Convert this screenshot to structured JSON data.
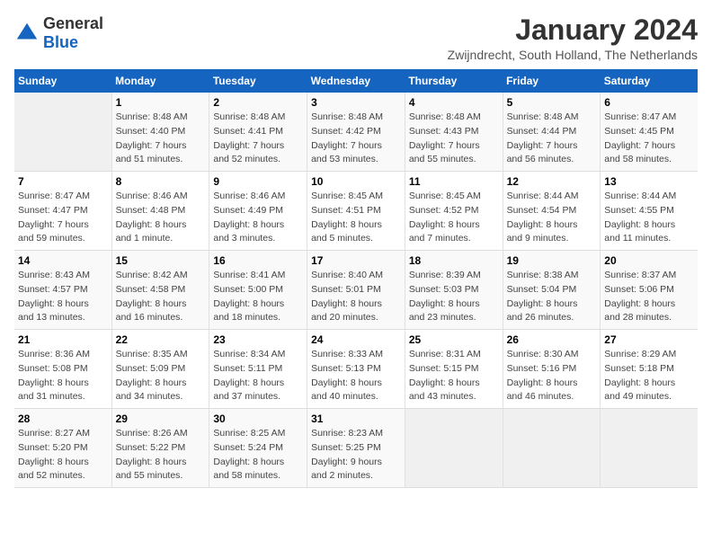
{
  "logo": {
    "general": "General",
    "blue": "Blue"
  },
  "title": "January 2024",
  "subtitle": "Zwijndrecht, South Holland, The Netherlands",
  "headers": [
    "Sunday",
    "Monday",
    "Tuesday",
    "Wednesday",
    "Thursday",
    "Friday",
    "Saturday"
  ],
  "weeks": [
    [
      {
        "day": "",
        "info": ""
      },
      {
        "day": "1",
        "info": "Sunrise: 8:48 AM\nSunset: 4:40 PM\nDaylight: 7 hours\nand 51 minutes."
      },
      {
        "day": "2",
        "info": "Sunrise: 8:48 AM\nSunset: 4:41 PM\nDaylight: 7 hours\nand 52 minutes."
      },
      {
        "day": "3",
        "info": "Sunrise: 8:48 AM\nSunset: 4:42 PM\nDaylight: 7 hours\nand 53 minutes."
      },
      {
        "day": "4",
        "info": "Sunrise: 8:48 AM\nSunset: 4:43 PM\nDaylight: 7 hours\nand 55 minutes."
      },
      {
        "day": "5",
        "info": "Sunrise: 8:48 AM\nSunset: 4:44 PM\nDaylight: 7 hours\nand 56 minutes."
      },
      {
        "day": "6",
        "info": "Sunrise: 8:47 AM\nSunset: 4:45 PM\nDaylight: 7 hours\nand 58 minutes."
      }
    ],
    [
      {
        "day": "7",
        "info": "Sunrise: 8:47 AM\nSunset: 4:47 PM\nDaylight: 7 hours\nand 59 minutes."
      },
      {
        "day": "8",
        "info": "Sunrise: 8:46 AM\nSunset: 4:48 PM\nDaylight: 8 hours\nand 1 minute."
      },
      {
        "day": "9",
        "info": "Sunrise: 8:46 AM\nSunset: 4:49 PM\nDaylight: 8 hours\nand 3 minutes."
      },
      {
        "day": "10",
        "info": "Sunrise: 8:45 AM\nSunset: 4:51 PM\nDaylight: 8 hours\nand 5 minutes."
      },
      {
        "day": "11",
        "info": "Sunrise: 8:45 AM\nSunset: 4:52 PM\nDaylight: 8 hours\nand 7 minutes."
      },
      {
        "day": "12",
        "info": "Sunrise: 8:44 AM\nSunset: 4:54 PM\nDaylight: 8 hours\nand 9 minutes."
      },
      {
        "day": "13",
        "info": "Sunrise: 8:44 AM\nSunset: 4:55 PM\nDaylight: 8 hours\nand 11 minutes."
      }
    ],
    [
      {
        "day": "14",
        "info": "Sunrise: 8:43 AM\nSunset: 4:57 PM\nDaylight: 8 hours\nand 13 minutes."
      },
      {
        "day": "15",
        "info": "Sunrise: 8:42 AM\nSunset: 4:58 PM\nDaylight: 8 hours\nand 16 minutes."
      },
      {
        "day": "16",
        "info": "Sunrise: 8:41 AM\nSunset: 5:00 PM\nDaylight: 8 hours\nand 18 minutes."
      },
      {
        "day": "17",
        "info": "Sunrise: 8:40 AM\nSunset: 5:01 PM\nDaylight: 8 hours\nand 20 minutes."
      },
      {
        "day": "18",
        "info": "Sunrise: 8:39 AM\nSunset: 5:03 PM\nDaylight: 8 hours\nand 23 minutes."
      },
      {
        "day": "19",
        "info": "Sunrise: 8:38 AM\nSunset: 5:04 PM\nDaylight: 8 hours\nand 26 minutes."
      },
      {
        "day": "20",
        "info": "Sunrise: 8:37 AM\nSunset: 5:06 PM\nDaylight: 8 hours\nand 28 minutes."
      }
    ],
    [
      {
        "day": "21",
        "info": "Sunrise: 8:36 AM\nSunset: 5:08 PM\nDaylight: 8 hours\nand 31 minutes."
      },
      {
        "day": "22",
        "info": "Sunrise: 8:35 AM\nSunset: 5:09 PM\nDaylight: 8 hours\nand 34 minutes."
      },
      {
        "day": "23",
        "info": "Sunrise: 8:34 AM\nSunset: 5:11 PM\nDaylight: 8 hours\nand 37 minutes."
      },
      {
        "day": "24",
        "info": "Sunrise: 8:33 AM\nSunset: 5:13 PM\nDaylight: 8 hours\nand 40 minutes."
      },
      {
        "day": "25",
        "info": "Sunrise: 8:31 AM\nSunset: 5:15 PM\nDaylight: 8 hours\nand 43 minutes."
      },
      {
        "day": "26",
        "info": "Sunrise: 8:30 AM\nSunset: 5:16 PM\nDaylight: 8 hours\nand 46 minutes."
      },
      {
        "day": "27",
        "info": "Sunrise: 8:29 AM\nSunset: 5:18 PM\nDaylight: 8 hours\nand 49 minutes."
      }
    ],
    [
      {
        "day": "28",
        "info": "Sunrise: 8:27 AM\nSunset: 5:20 PM\nDaylight: 8 hours\nand 52 minutes."
      },
      {
        "day": "29",
        "info": "Sunrise: 8:26 AM\nSunset: 5:22 PM\nDaylight: 8 hours\nand 55 minutes."
      },
      {
        "day": "30",
        "info": "Sunrise: 8:25 AM\nSunset: 5:24 PM\nDaylight: 8 hours\nand 58 minutes."
      },
      {
        "day": "31",
        "info": "Sunrise: 8:23 AM\nSunset: 5:25 PM\nDaylight: 9 hours\nand 2 minutes."
      },
      {
        "day": "",
        "info": ""
      },
      {
        "day": "",
        "info": ""
      },
      {
        "day": "",
        "info": ""
      }
    ]
  ]
}
